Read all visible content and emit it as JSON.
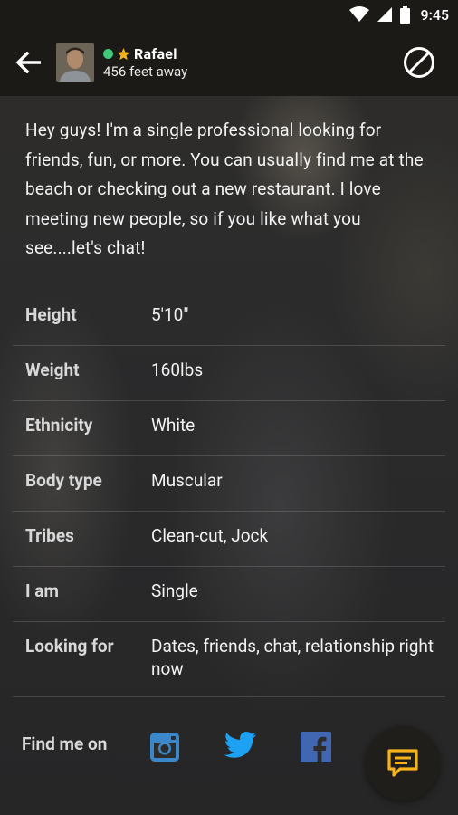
{
  "status_bar": {
    "time": "9:45"
  },
  "header": {
    "name": "Rafael",
    "distance": "456 feet away",
    "online_color": "#3ec877",
    "favorite_color": "#f5b21b"
  },
  "bio": "Hey guys! I'm a single professional looking for friends, fun, or more. You can usually find me at the beach or checking out a new restaurant. I love meeting new people, so if you like what you see....let's chat!",
  "details": [
    {
      "label": "Height",
      "value": "5′10″"
    },
    {
      "label": "Weight",
      "value": "160lbs"
    },
    {
      "label": "Ethnicity",
      "value": "White"
    },
    {
      "label": "Body type",
      "value": "Muscular"
    },
    {
      "label": "Tribes",
      "value": "Clean-cut, Jock"
    },
    {
      "label": "I am",
      "value": "Single"
    },
    {
      "label": "Looking for",
      "value": "Dates, friends, chat, relationship right now"
    }
  ],
  "social": {
    "label": "Find me on",
    "networks": [
      "instagram-icon",
      "twitter-icon",
      "facebook-icon"
    ]
  },
  "colors": {
    "accent": "#f5b21b",
    "background": "#1b1a17"
  }
}
